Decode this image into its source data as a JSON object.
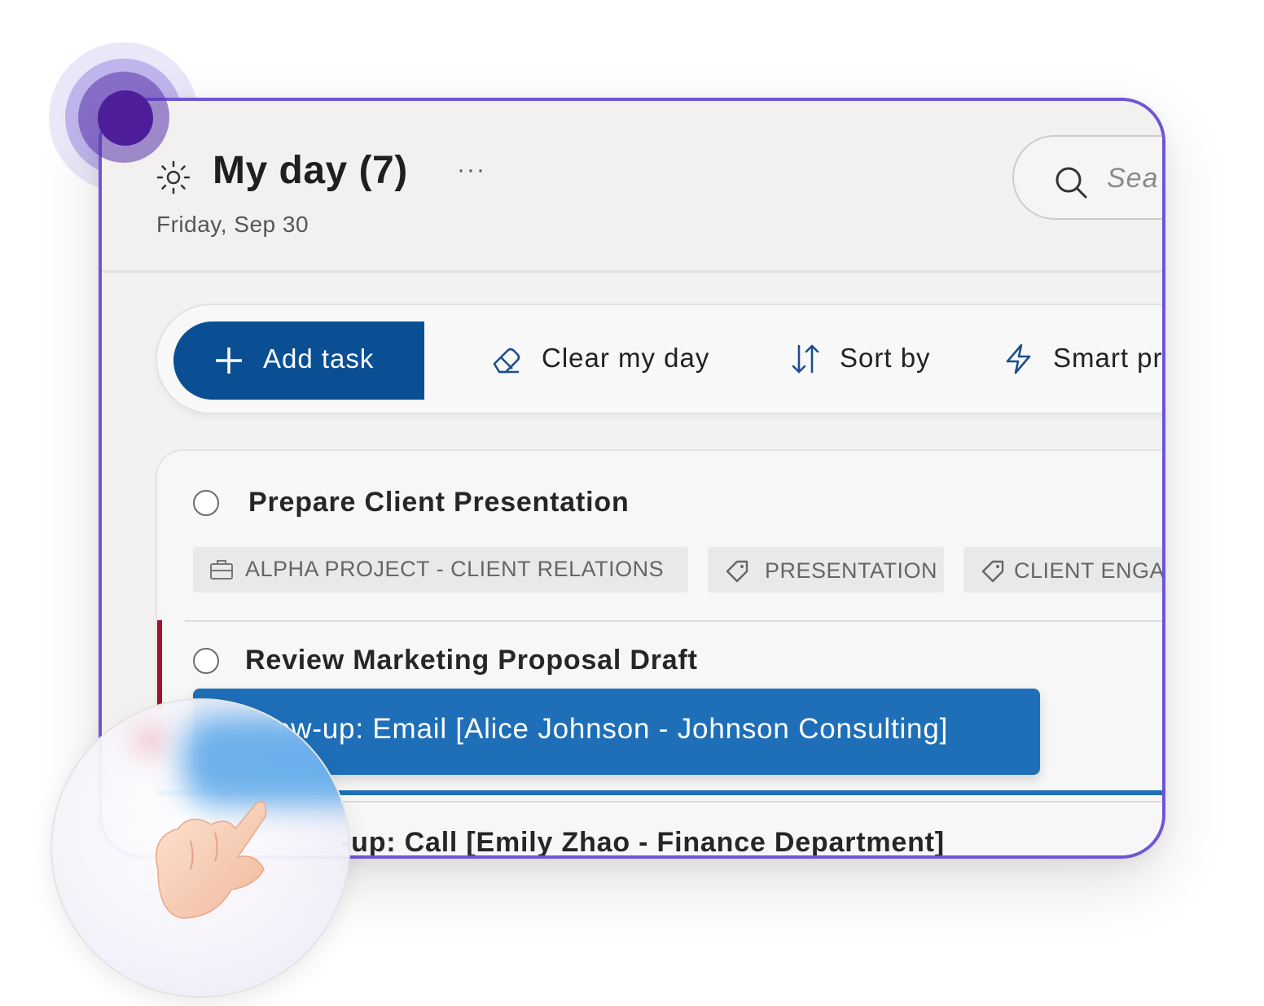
{
  "header": {
    "title": "My day (7)",
    "date": "Friday, Sep 30",
    "more": "···",
    "search_placeholder": "Sea"
  },
  "toolbar": {
    "add_task": "Add task",
    "clear_my_day": "Clear my day",
    "sort_by": "Sort by",
    "smart": "Smart pr"
  },
  "tasks": [
    {
      "title": "Prepare Client Presentation",
      "chips": [
        "ALPHA PROJECT - CLIENT RELATIONS",
        "PRESENTATION",
        "CLIENT ENGAG"
      ]
    },
    {
      "title": "Review Marketing Proposal Draft"
    },
    {
      "title": "-up: Call [Emily Zhao - Finance Department]"
    }
  ],
  "dragging_task": "ow-up: Email [Alice Johnson - Johnson Consulting]",
  "colors": {
    "accent": "#6f55d6",
    "primary": "#0a4f93",
    "drag": "#1e6fb8",
    "priority": "#a2122d"
  },
  "icons": [
    "sun-icon",
    "more-icon",
    "search-icon",
    "plus-icon",
    "eraser-icon",
    "sort-icon",
    "lightning-icon",
    "briefcase-icon",
    "tag-icon",
    "hand-pointer-icon"
  ]
}
